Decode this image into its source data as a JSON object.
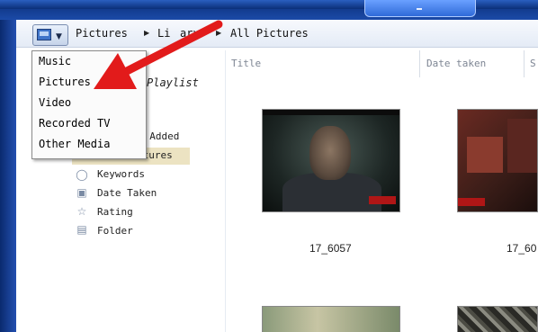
{
  "breadcrumb": {
    "items": [
      "Pictures",
      "Library",
      "All Pictures"
    ],
    "library_visible": "Li",
    "library_tail": "ary"
  },
  "columns": {
    "title": "Title",
    "date_taken": "Date taken",
    "cut_off": "S"
  },
  "dropdown_menu": {
    "items": [
      "Music",
      "Pictures",
      "Video",
      "Recorded TV",
      "Other Media"
    ]
  },
  "sidebar": {
    "playlist_partial": "Playlist",
    "recently_added_partial": "y Added",
    "all_pictures_partial": "ctures",
    "items": [
      {
        "label": "Keywords",
        "icon": "tag-icon"
      },
      {
        "label": "Date Taken",
        "icon": "calendar-icon"
      },
      {
        "label": "Rating",
        "icon": "star-icon"
      },
      {
        "label": "Folder",
        "icon": "folder-icon"
      }
    ]
  },
  "thumbnails": [
    {
      "caption": "17_6057"
    },
    {
      "caption": "17_60"
    }
  ],
  "colors": {
    "frame": "#0b2f78",
    "annotation_arrow": "#e21b1b",
    "selection": "#ece3c2"
  }
}
